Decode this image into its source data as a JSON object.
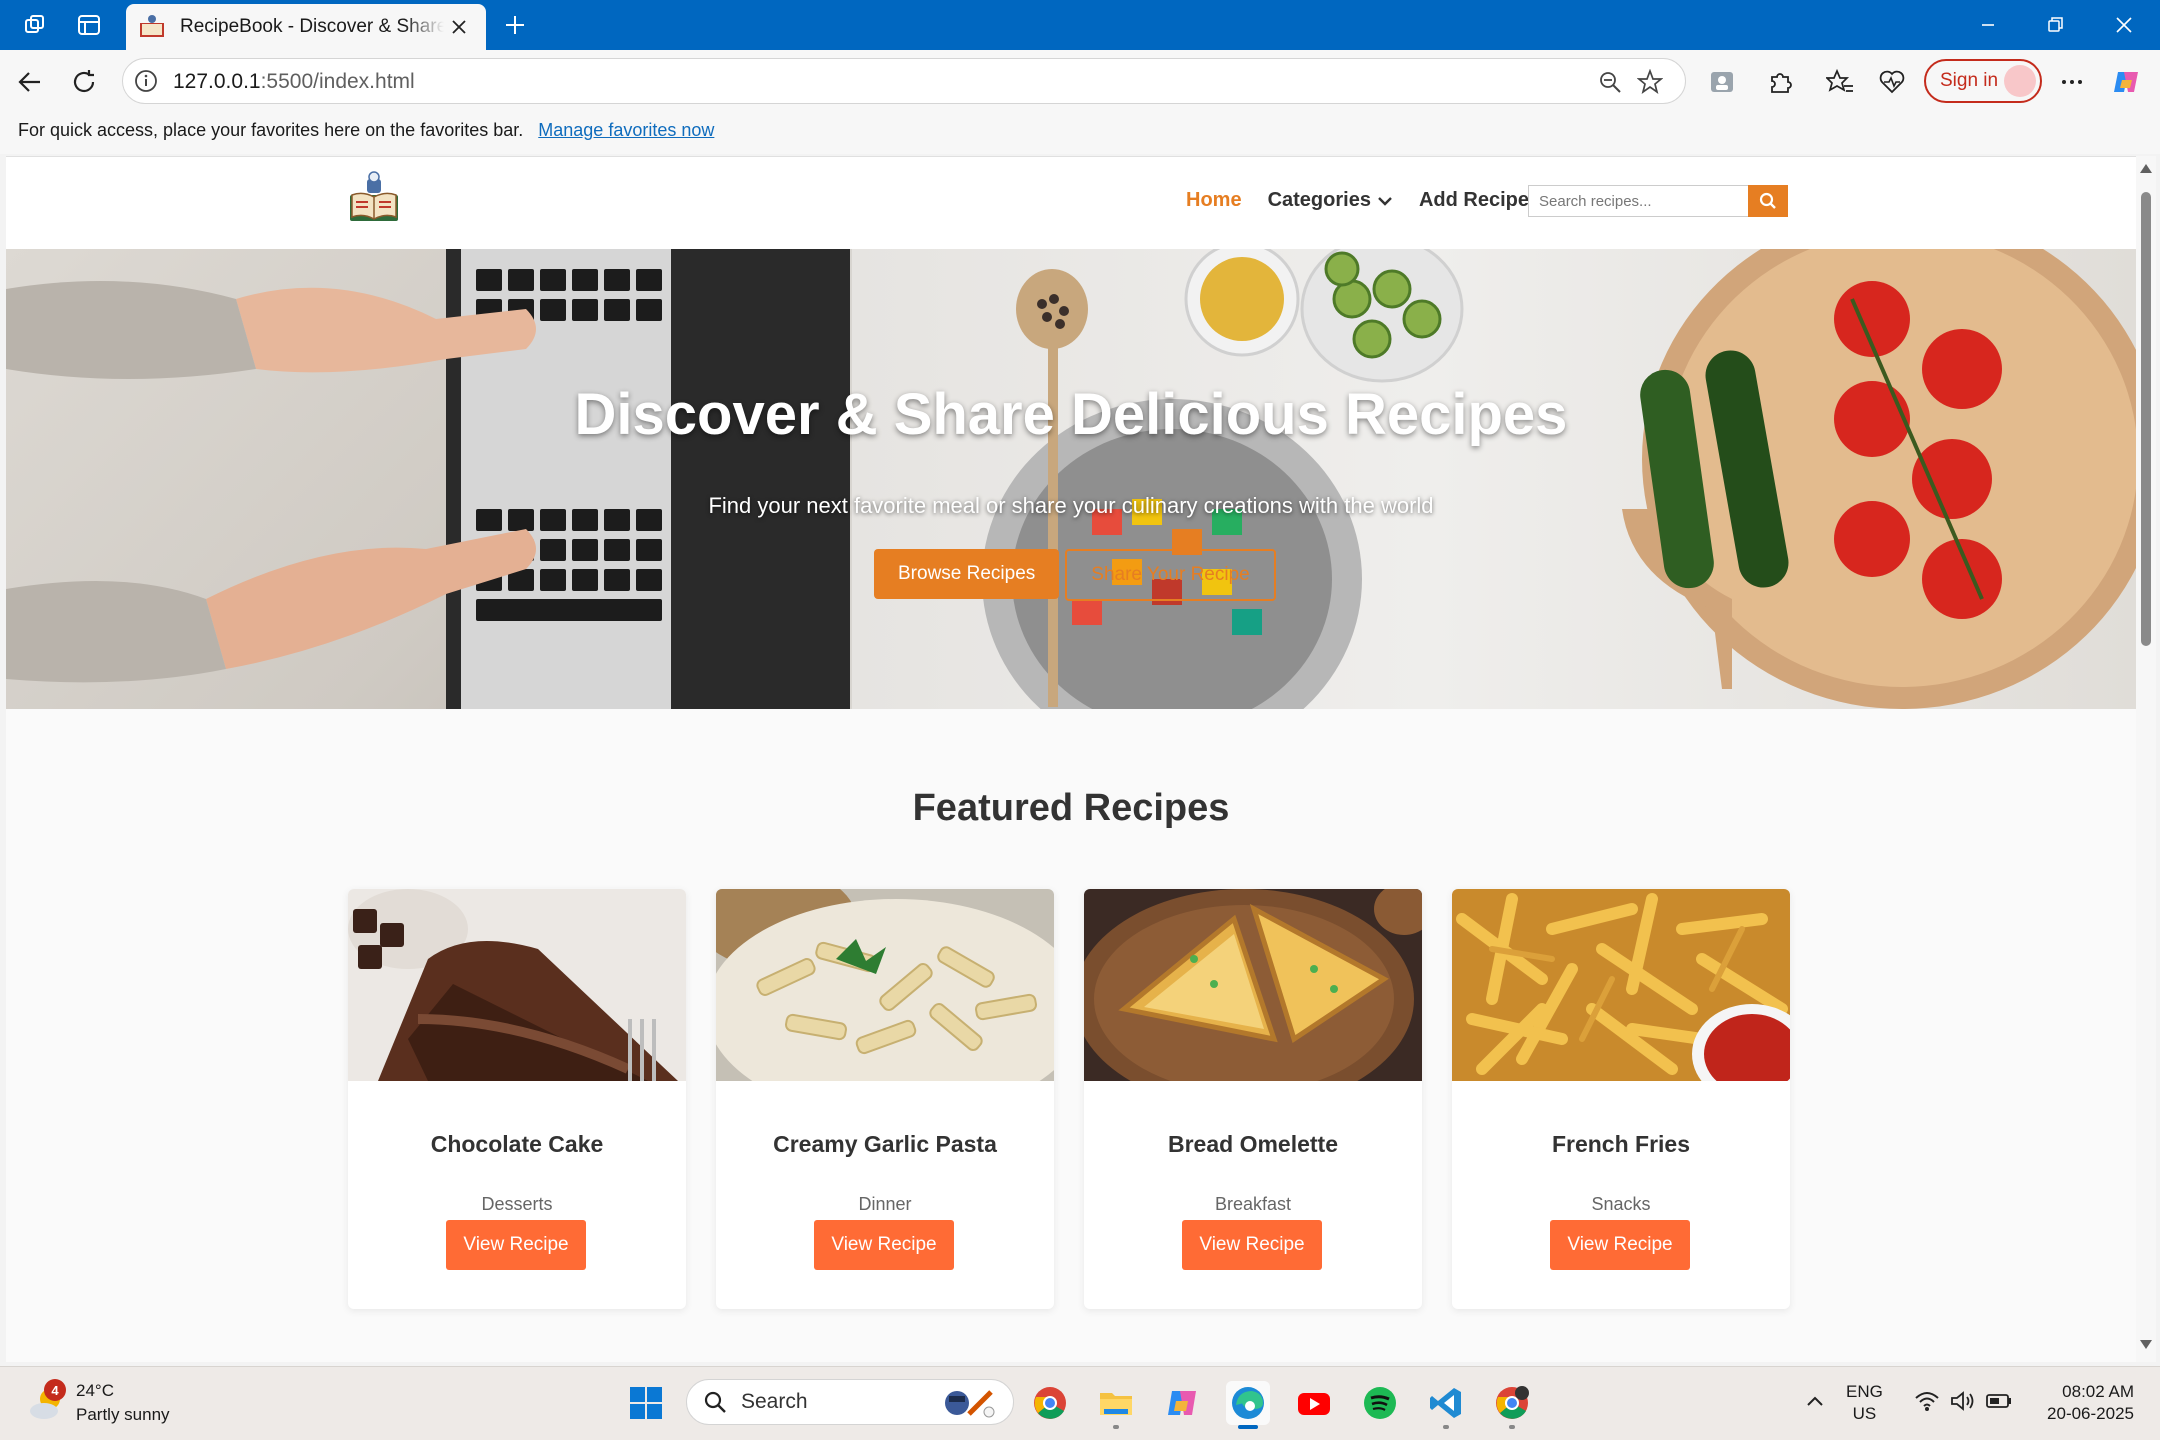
{
  "browser": {
    "tab_title": "RecipeBook - Discover & Share Recipes",
    "url_host": "127.0.0.1",
    "url_path": ":5500/index.html",
    "sign_in_label": "Sign in",
    "favorites_message": "For quick access, place your favorites here on the favorites bar.",
    "favorites_link": "Manage favorites now"
  },
  "site": {
    "nav": {
      "home": "Home",
      "categories": "Categories",
      "add_recipe": "Add Recipe"
    },
    "search_placeholder": "Search recipes...",
    "hero": {
      "title": "Discover & Share Delicious Recipes",
      "subtitle": "Find your next favorite meal or share your culinary creations with the world",
      "browse_button": "Browse Recipes",
      "share_button": "Share Your Recipe"
    },
    "featured_title": "Featured Recipes",
    "recipes": [
      {
        "name": "Chocolate Cake",
        "category": "Desserts",
        "button": "View Recipe"
      },
      {
        "name": "Creamy Garlic Pasta",
        "category": "Dinner",
        "button": "View Recipe"
      },
      {
        "name": "Bread Omelette",
        "category": "Breakfast",
        "button": "View Recipe"
      },
      {
        "name": "French Fries",
        "category": "Snacks",
        "button": "View Recipe"
      }
    ],
    "colors": {
      "accent": "#e67e22",
      "card_button": "#ff6b35"
    }
  },
  "taskbar": {
    "weather_temp": "24°C",
    "weather_desc": "Partly sunny",
    "weather_badge": "4",
    "search_label": "Search",
    "lang_line1": "ENG",
    "lang_line2": "US",
    "time": "08:02 AM",
    "date": "20-06-2025"
  }
}
